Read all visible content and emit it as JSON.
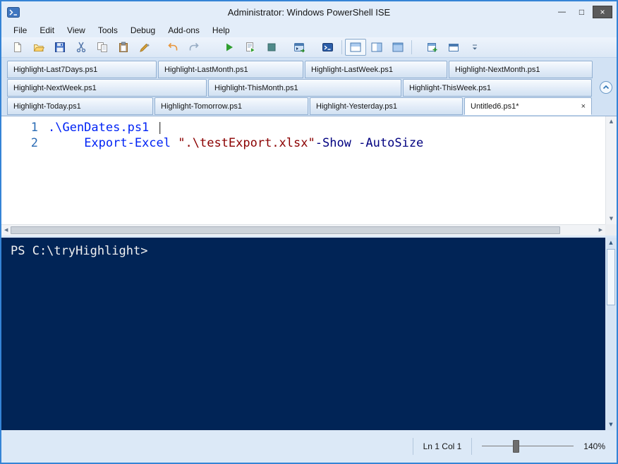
{
  "window": {
    "title": "Administrator: Windows PowerShell ISE"
  },
  "glyphs": {
    "minimize": "—",
    "maximize": "□",
    "close": "×",
    "tab_close": "×",
    "arrow_up": "▲",
    "arrow_down": "▼",
    "arrow_left": "◀",
    "arrow_right": "▶"
  },
  "menubar": {
    "items": [
      "File",
      "Edit",
      "View",
      "Tools",
      "Debug",
      "Add-ons",
      "Help"
    ]
  },
  "toolbar": {
    "icons": [
      "new-script",
      "open-script",
      "save-script",
      "cut",
      "copy",
      "paste",
      "clear-console-pane",
      "undo",
      "redo",
      "run-script",
      "run-selection",
      "stop-operation",
      "new-remote-powershell-tab",
      "start-powershell",
      "show-script-pane-top",
      "show-script-pane-right",
      "show-script-pane-maximized",
      "show-command-window",
      "new-powershell-tab",
      "toolbar-overflow"
    ]
  },
  "tabs": {
    "rows": [
      [
        "Highlight-Last7Days.ps1",
        "Highlight-LastMonth.ps1",
        "Highlight-LastWeek.ps1",
        "Highlight-NextMonth.ps1"
      ],
      [
        "Highlight-NextWeek.ps1",
        "Highlight-ThisMonth.ps1",
        "Highlight-ThisWeek.ps1"
      ],
      [
        "Highlight-Today.ps1",
        "Highlight-Tomorrow.ps1",
        "Highlight-Yesterday.ps1",
        "Untitled6.ps1*"
      ]
    ],
    "active_tab": "Untitled6.ps1*"
  },
  "editor": {
    "lines": [
      {
        "number": "1",
        "segments": [
          {
            "type": "command",
            "text": ".\\GenDates.ps1"
          },
          {
            "type": "plain",
            "text": " "
          },
          {
            "type": "operator",
            "text": "|"
          }
        ]
      },
      {
        "number": "2",
        "segments": [
          {
            "type": "plain",
            "text": "     "
          },
          {
            "type": "command",
            "text": "Export-Excel"
          },
          {
            "type": "plain",
            "text": " "
          },
          {
            "type": "string",
            "text": "\".\\testExport.xlsx\""
          },
          {
            "type": "parameter",
            "text": "-Show"
          },
          {
            "type": "plain",
            "text": " "
          },
          {
            "type": "parameter",
            "text": "-AutoSize"
          }
        ]
      }
    ]
  },
  "console": {
    "prompt": "PS C:\\tryHighlight>"
  },
  "statusbar": {
    "line_col": "Ln 1 Col 1",
    "zoom_percent": "140%"
  }
}
